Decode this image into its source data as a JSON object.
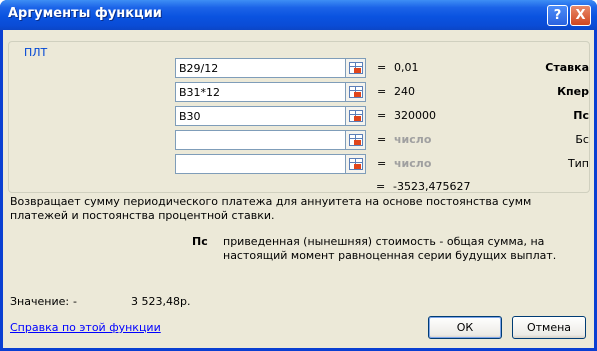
{
  "window": {
    "title": "Аргументы функции",
    "help_label": "?",
    "close_label": "X"
  },
  "group_label": "ПЛТ",
  "args": [
    {
      "label": "Ставка",
      "value": "B29/12",
      "result": "0,01",
      "required": true
    },
    {
      "label": "Кпер",
      "value": "B31*12",
      "result": "240",
      "required": true
    },
    {
      "label": "Пс",
      "value": "B30",
      "result": "320000",
      "required": true
    },
    {
      "label": "Бс",
      "value": "",
      "result": "число",
      "required": false
    },
    {
      "label": "Тип",
      "value": "",
      "result": "число",
      "required": false
    }
  ],
  "equals": "=",
  "formula_result": "-3523,475627",
  "description": "Возвращает сумму периодического платежа для аннуитета на основе постоянства сумм платежей и постоянства процентной ставки.",
  "current_arg": {
    "name": "Пс",
    "description": "приведенная (нынешняя) стоимость - общая сумма, на настоящий момент равноценная серии будущих выплат."
  },
  "value_label": "Значение:",
  "value_dash": "-",
  "value_result": "3 523,48р.",
  "help_link": "Справка по этой функции",
  "ok_label": "ОК",
  "cancel_label": "Отмена"
}
